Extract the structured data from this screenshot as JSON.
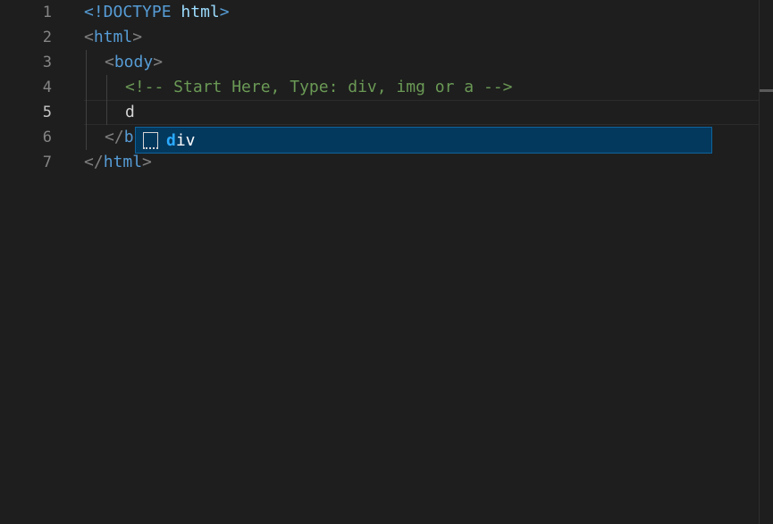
{
  "editor": {
    "line_numbers": [
      "1",
      "2",
      "3",
      "4",
      "5",
      "6",
      "7"
    ],
    "active_line": "5",
    "lines": {
      "l1": {
        "open": "<!DOCTYPE",
        "space": " ",
        "attr": "html",
        "close": ">"
      },
      "l2": {
        "open": "<",
        "tag": "html",
        "close": ">"
      },
      "l3": {
        "open": "<",
        "tag": "body",
        "close": ">"
      },
      "l4": {
        "comment": "<!-- Start Here, Type: div, img or a -->"
      },
      "l5": {
        "text": "d"
      },
      "l6": {
        "open": "</",
        "partial": "b"
      },
      "l7": {
        "open": "</",
        "tag": "html",
        "close": ">"
      }
    }
  },
  "autocomplete": {
    "items": [
      {
        "icon": "snippet-icon",
        "match": "d",
        "rest": "iv"
      }
    ]
  },
  "colors": {
    "background": "#1e1e1e",
    "tag": "#569cd6",
    "comment": "#6a9955",
    "suggest_selected": "#04395e",
    "suggest_highlight": "#2aaaff"
  }
}
